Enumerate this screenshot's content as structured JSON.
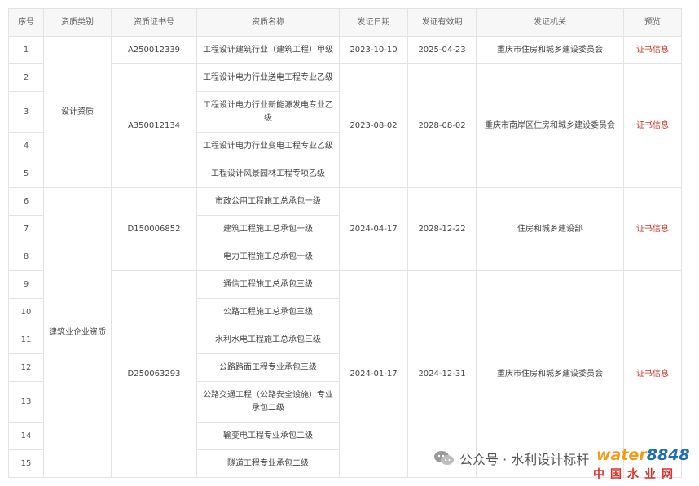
{
  "headers": [
    "序号",
    "资质类别",
    "资质证书号",
    "资质名称",
    "发证日期",
    "发证有效期",
    "发证机关",
    "预览"
  ],
  "categories": [
    "设计资质",
    "建筑业企业资质"
  ],
  "groups": [
    {
      "cert": "A250012339",
      "issue": "2023-10-10",
      "valid": "2025-04-23",
      "authority": "重庆市住房和城乡建设委员会",
      "preview": "证书信息"
    },
    {
      "cert": "A350012134",
      "issue": "2023-08-02",
      "valid": "2028-08-02",
      "authority": "重庆市南岸区住房和城乡建设委员会",
      "preview": "证书信息"
    },
    {
      "cert": "D150006852",
      "issue": "2024-04-17",
      "valid": "2028-12-22",
      "authority": "住房和城乡建设部",
      "preview": "证书信息"
    },
    {
      "cert": "D250063293",
      "issue": "2024-01-17",
      "valid": "2024-12-31",
      "authority": "重庆市住房和城乡建设委员会",
      "preview": "证书信息"
    }
  ],
  "rows": [
    {
      "no": "1",
      "name": "工程设计建筑行业（建筑工程）甲级"
    },
    {
      "no": "2",
      "name": "工程设计电力行业送电工程专业乙级"
    },
    {
      "no": "3",
      "name": "工程设计电力行业新能源发电专业乙级"
    },
    {
      "no": "4",
      "name": "工程设计电力行业变电工程专业乙级"
    },
    {
      "no": "5",
      "name": "工程设计风景园林工程专项乙级"
    },
    {
      "no": "6",
      "name": "市政公用工程施工总承包一级"
    },
    {
      "no": "7",
      "name": "建筑工程施工总承包一级"
    },
    {
      "no": "8",
      "name": "电力工程施工总承包一级"
    },
    {
      "no": "9",
      "name": "通信工程施工总承包三级"
    },
    {
      "no": "10",
      "name": "公路工程施工总承包三级"
    },
    {
      "no": "11",
      "name": "水利水电工程施工总承包三级"
    },
    {
      "no": "12",
      "name": "公路路面工程专业承包三级"
    },
    {
      "no": "13",
      "name": "公路交通工程（公路安全设施）专业承包二级"
    },
    {
      "no": "14",
      "name": "输变电工程专业承包二级"
    },
    {
      "no": "15",
      "name": "隧道工程专业承包二级"
    }
  ],
  "watermark": {
    "account": "公众号 · 水利设计标杆",
    "brand_a": "water",
    "brand_b": "8848",
    "site": "中国水业网"
  }
}
